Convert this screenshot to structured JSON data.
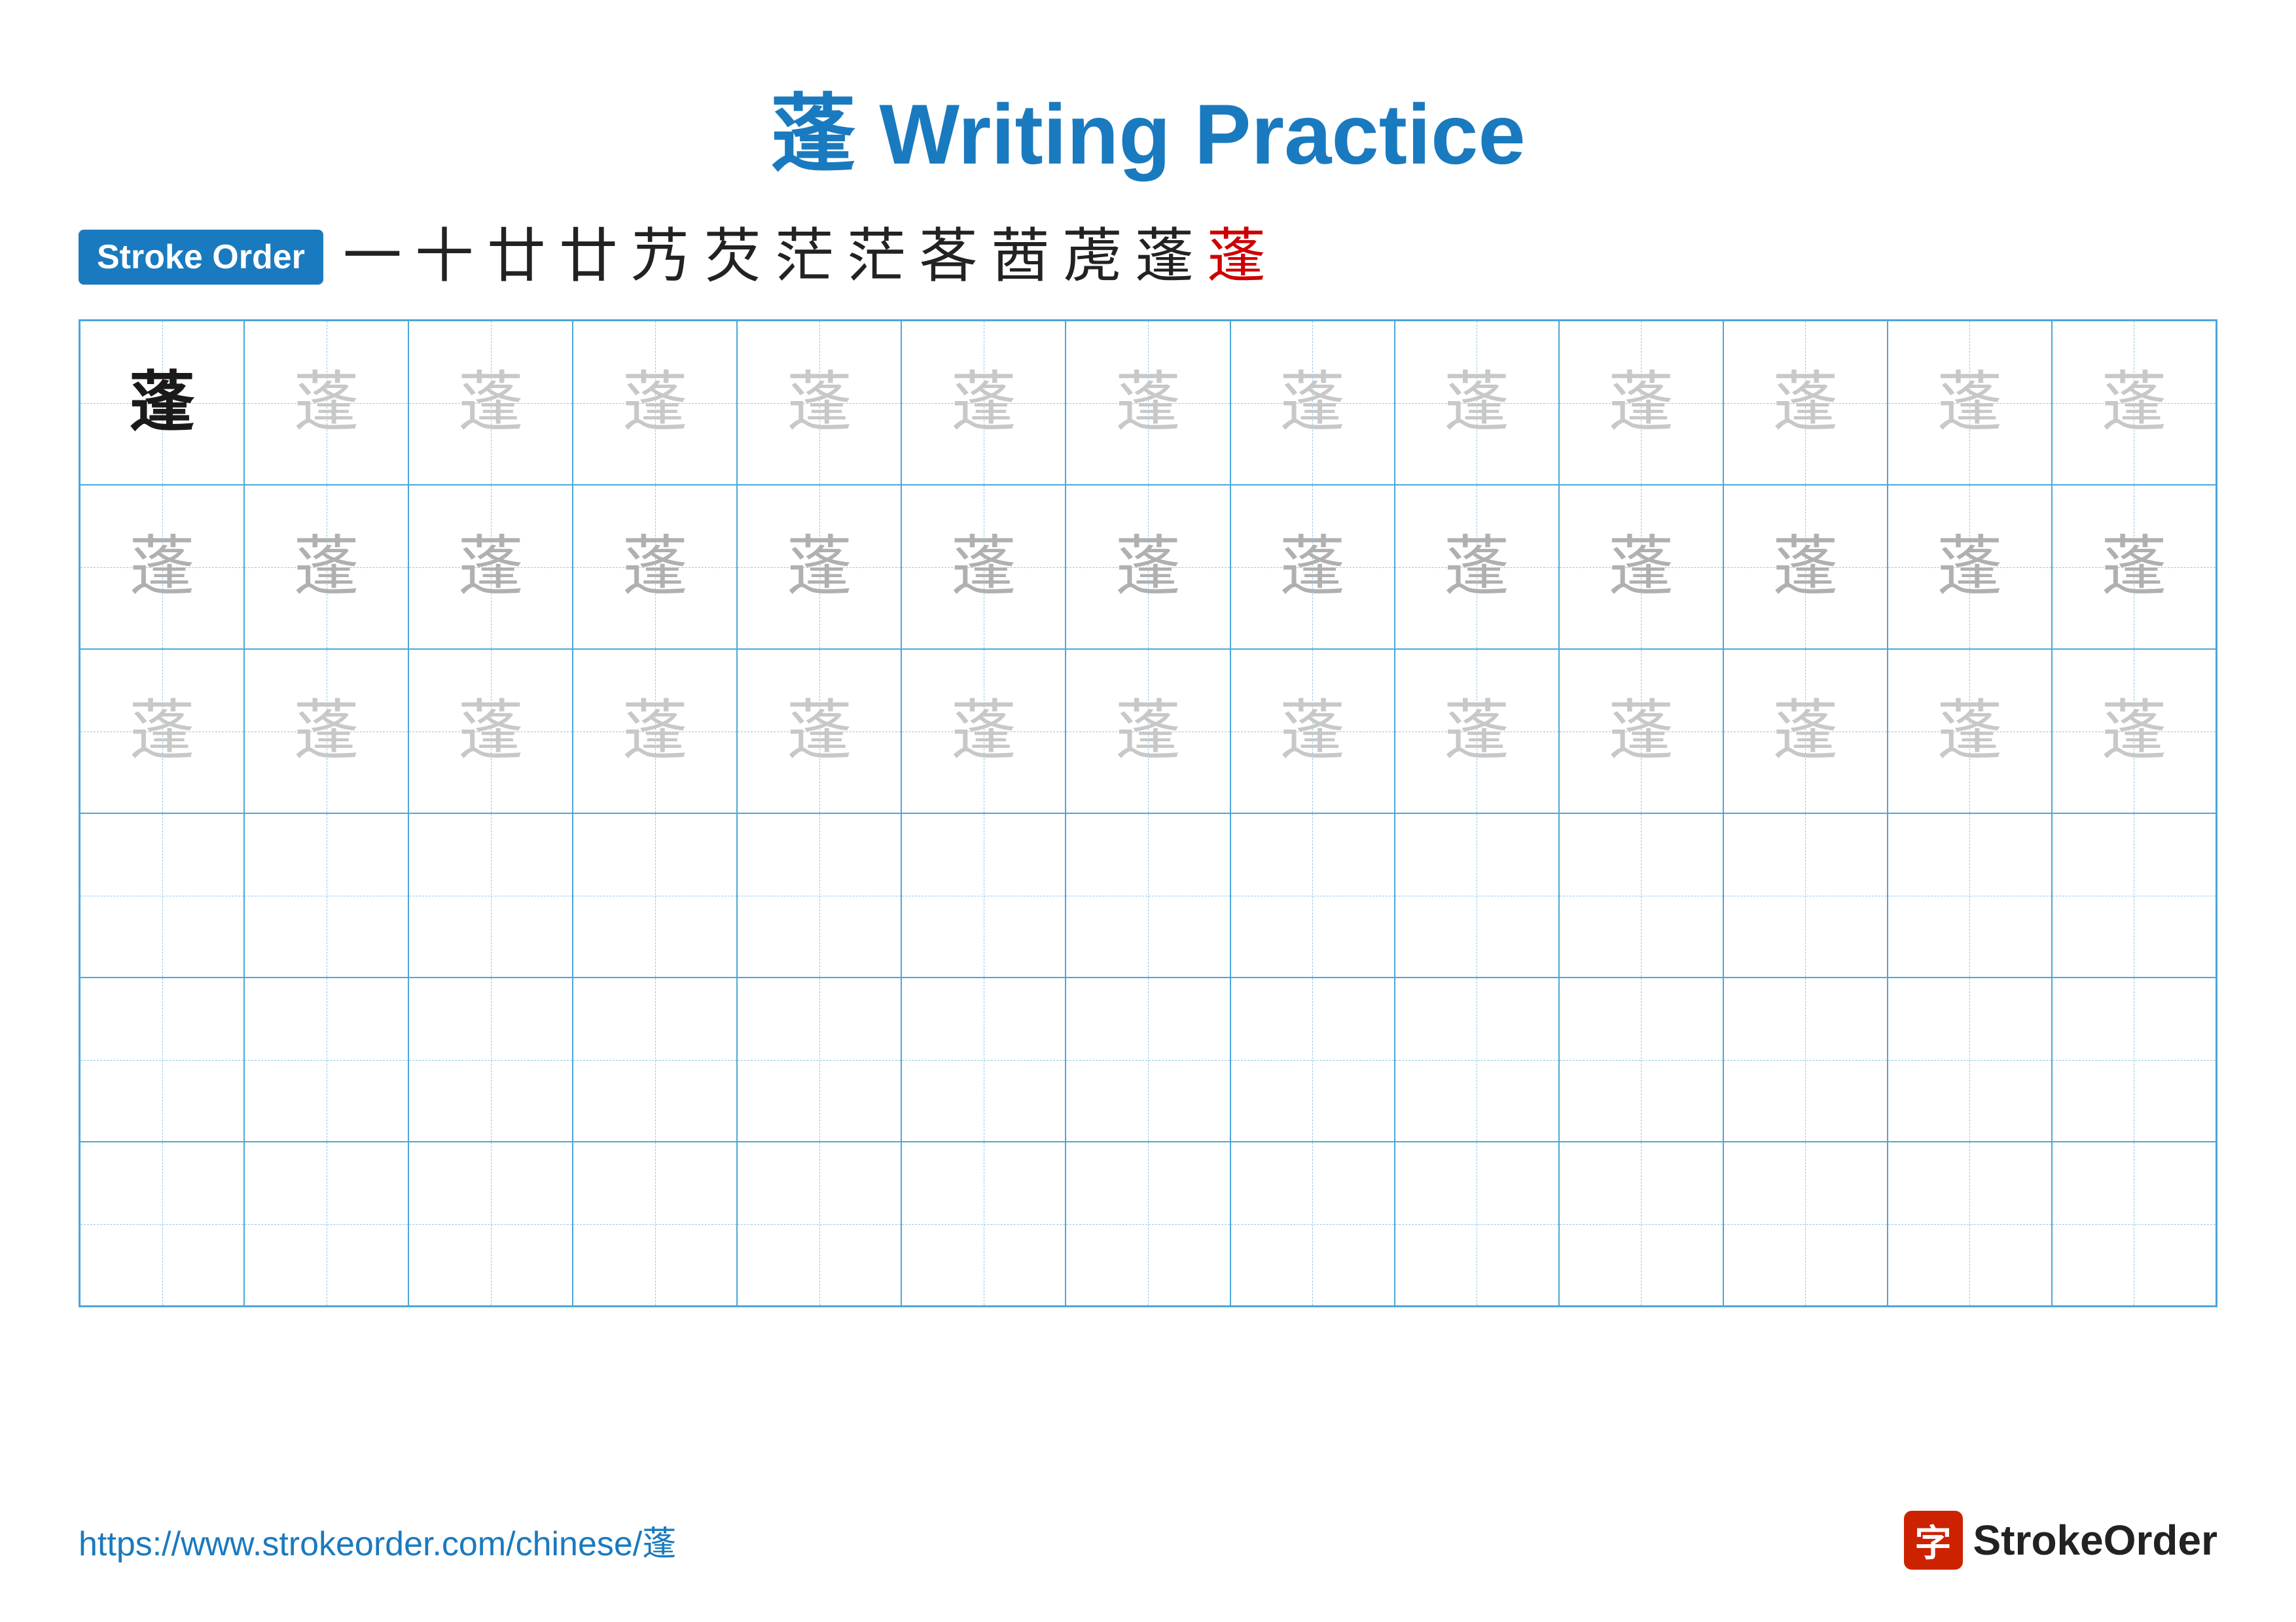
{
  "title": {
    "char": "蓬",
    "text": " Writing Practice"
  },
  "stroke_order": {
    "badge_label": "Stroke Order",
    "strokes": [
      "一",
      "十",
      "廿",
      "廿",
      "艿",
      "芡",
      "茫",
      "茫",
      "茖",
      "莤",
      "萀",
      "蓬",
      "蓬"
    ]
  },
  "grid": {
    "rows": 6,
    "cols": 13,
    "character": "蓬",
    "row_styles": [
      "row1",
      "row2",
      "row3",
      "row4",
      "row5",
      "row6"
    ]
  },
  "footer": {
    "url": "https://www.strokeorder.com/chinese/蓬",
    "logo_char": "字",
    "logo_text": "StrokeOrder"
  }
}
